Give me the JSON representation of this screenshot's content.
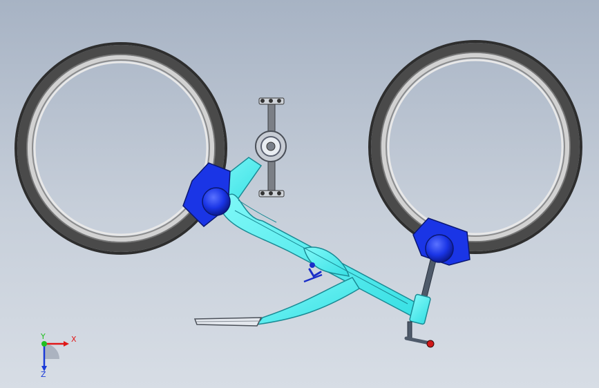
{
  "viewport": {
    "background_top": "#a7b3c4",
    "background_bottom": "#d7dde5"
  },
  "model": {
    "parts": {
      "front_wheel": "tire-and-rim",
      "rear_wheel": "tire-and-rim",
      "frame": "main-frame",
      "seat": "saddle",
      "crankset": "crank-and-pedals",
      "front_hub": "hub-clamp",
      "rear_hub": "hub-clamp",
      "handle": "steering-handle"
    },
    "colors": {
      "tire": "#3f3f3f",
      "rim": "#c9c9c9",
      "frame": "#4ef0f0",
      "frame_outline": "#1a8a94",
      "hub": "#1a35e6",
      "handle_knob": "#d01818",
      "logo": "#1a2ec8"
    }
  },
  "triad": {
    "x_label": "X",
    "y_label": "Y",
    "z_label": "Z",
    "colors": {
      "x": "#e01818",
      "y": "#20c020",
      "z": "#1a3ad8"
    }
  }
}
